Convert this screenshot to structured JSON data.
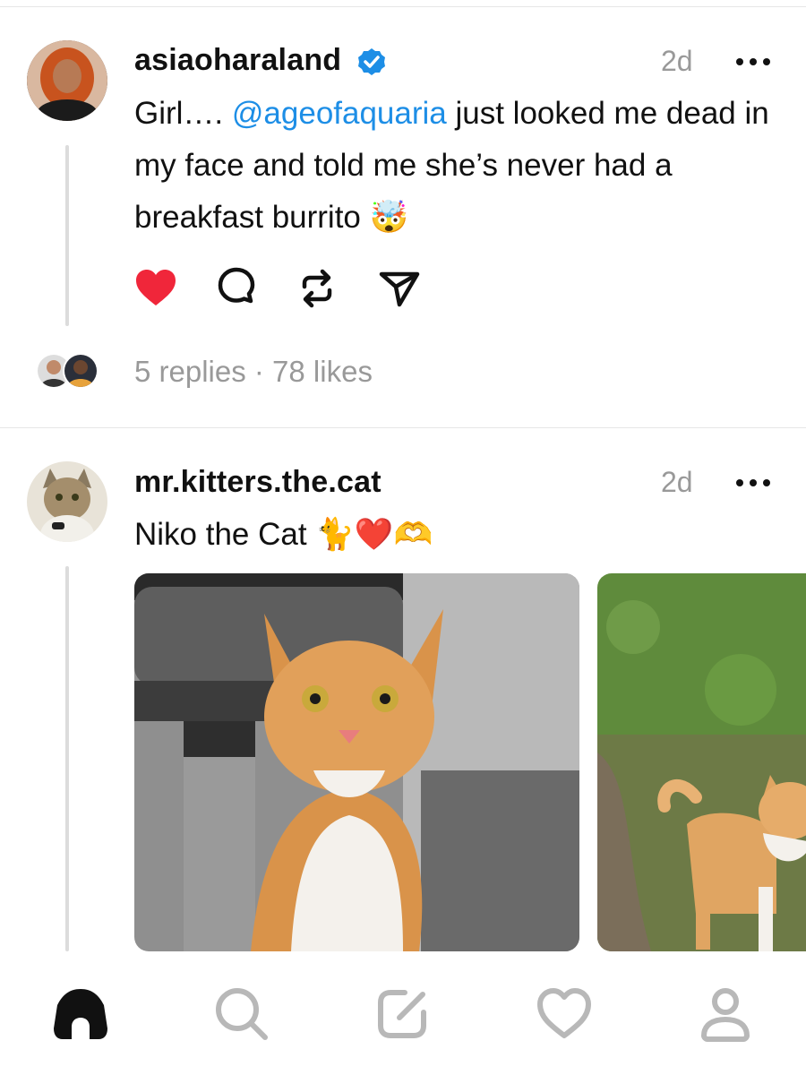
{
  "posts": [
    {
      "username": "asiaoharaland",
      "verified": true,
      "time": "2d",
      "text_before": "Girl…. ",
      "mention": "@ageofaquaria",
      "text_after": " just looked me dead in my face and told me she’s never had a breakfast burrito",
      "emoji": "🤯",
      "liked": true,
      "meta": "5 replies · 78 likes"
    },
    {
      "username": "mr.kitters.the.cat",
      "verified": false,
      "time": "2d",
      "text": "Niko the Cat ",
      "emoji": "🐈❤️🫶"
    }
  ],
  "colors": {
    "like_red": "#f0263a",
    "mention_blue": "#1d8ee6",
    "muted_gray": "#999999"
  },
  "tabs": [
    "home-icon",
    "search-icon",
    "compose-icon",
    "activity-heart-icon",
    "profile-icon"
  ]
}
